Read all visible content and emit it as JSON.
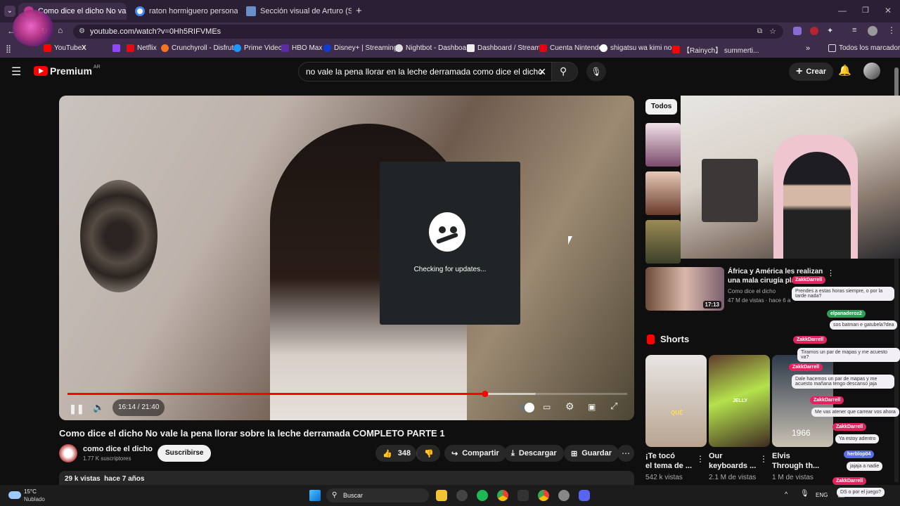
{
  "browser": {
    "tabs": [
      {
        "title": "Como dice el dicho No vale",
        "active": true
      },
      {
        "title": "raton hormiguero personajes a",
        "active": false
      },
      {
        "title": "Sección visual de Arturo (Serie",
        "active": false
      }
    ],
    "new_tab": "+",
    "url": "youtube.com/watch?v=0Hh5RIFVMEs",
    "bookmarks": [
      "YouTube",
      "X",
      "Netflix",
      "Crunchyroll - Disfrut...",
      "Prime Video",
      "HBO Max",
      "Disney+ | Streaming...",
      "Nightbot - Dashboa...",
      "Dashboard / Stream...",
      "Cuenta Nintendo",
      "shigatsu wa kimi no...",
      "【Rainych】 summerti..."
    ],
    "all_bookmarks": "Todos los marcadores"
  },
  "youtube": {
    "logo": "Premium",
    "logo_region": "AR",
    "search_query": "no vale la pena llorar en la leche derramada como dice el dicho",
    "create_label": "Crear",
    "player": {
      "time": "16:14 / 21:40",
      "progress_fraction": 0.746,
      "buffer_fraction": 0.836
    },
    "video_title": "Como dice el dicho No vale la pena llorar sobre la leche derramada COMPLETO PARTE 1",
    "channel": {
      "name": "como dice el dicho",
      "subscribers": "1.77 K suscriptores",
      "subscribe_label": "Suscribirse"
    },
    "actions": {
      "likes": "348",
      "share": "Compartir",
      "download": "Descargar",
      "save": "Guardar"
    },
    "description_stats": "29 k vistas  hace 7 años",
    "chips": [
      "Todos"
    ],
    "recommended": {
      "title_line1": "África y América les realizan",
      "title_line2": "una mala cirugía plás",
      "channel": "Como dice el dicho",
      "meta": "47 M de vistas · hace 6 a",
      "duration": "17:13"
    },
    "shorts_heading": "Shorts",
    "shorts": [
      {
        "title_line1": "¡Te tocó",
        "title_line2": "el tema de ...",
        "views": "542 k vistas",
        "overlay": "QUÉ"
      },
      {
        "title_line1": "Our",
        "title_line2": "keyboards ...",
        "views": "2.1 M de vistas",
        "overlay": "JELLY"
      },
      {
        "title_line1": "Elvis",
        "title_line2": "Through th...",
        "views": "1 M de vistas",
        "overlay": "1966"
      }
    ]
  },
  "overlay_popup": {
    "text": "Checking for updates..."
  },
  "stream_chat": [
    {
      "user": "ZakkDarrell",
      "msg": "Prendes a estas horas siempre, o por la tarde nada?",
      "color": "#e0245e"
    },
    {
      "user": "elpanaderoz2",
      "msg": "sos batman e gatubela?dea",
      "color": "#2e9e55"
    },
    {
      "user": "ZakkDarrell",
      "msg": "Tiramos un par de mapas y me acuesto va?",
      "color": "#e0245e"
    },
    {
      "user": "ZakkDarrell",
      "msg": "Dale hacemos un par de mapas y me acuesto mañana tengo descanso jaja",
      "color": "#e0245e"
    },
    {
      "user": "ZakkDarrell",
      "msg": "Me vas atener que carrear vos ahora",
      "color": "#e0245e"
    },
    {
      "user": "ZakkDarrell",
      "msg": "Ya estoy adentro",
      "color": "#e0245e"
    },
    {
      "user": "herblop04",
      "msg": "jajaja a nadie",
      "color": "#5a6ee0"
    },
    {
      "user": "ZakkDarrell",
      "msg": "DS o por el juego?",
      "color": "#e0245e"
    }
  ],
  "taskbar": {
    "weather_temp": "15°C",
    "weather_desc": "Nublado",
    "search_label": "Buscar",
    "lang": "ENG"
  }
}
